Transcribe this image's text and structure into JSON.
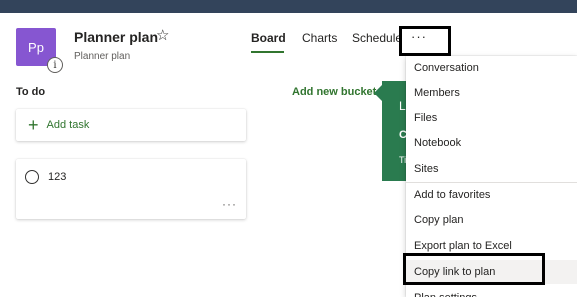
{
  "plan": {
    "avatar_initials": "Pp",
    "info_badge": "i",
    "title": "Planner plan",
    "star_icon": "☆",
    "subtitle": "Planner plan"
  },
  "tabs": [
    {
      "label": "Board",
      "active": true
    },
    {
      "label": "Charts",
      "active": false
    },
    {
      "label": "Schedule",
      "active": false
    }
  ],
  "more_icon": "···",
  "bucket": {
    "title": "To do",
    "add_task_icon": "+",
    "add_task_label": "Add task"
  },
  "task": {
    "title": "123",
    "more_icon": "···"
  },
  "add_bucket_label": "Add new bucket",
  "teaching_callout": {
    "partial_line1": "L",
    "partial_line2": "C",
    "partial_line3": "Ti"
  },
  "menu": {
    "items": [
      {
        "label": "Conversation"
      },
      {
        "label": "Members"
      },
      {
        "label": "Files"
      },
      {
        "label": "Notebook"
      },
      {
        "label": "Sites"
      },
      {
        "label": "Add to favorites"
      },
      {
        "label": "Copy plan"
      },
      {
        "label": "Export plan to Excel"
      },
      {
        "label": "Copy link to plan"
      },
      {
        "label": "Plan settings"
      }
    ]
  },
  "colors": {
    "topbar": "#33445b",
    "accent_green": "#31752f",
    "callout_green": "#2a7b4f",
    "avatar_purple": "#8656d1"
  }
}
